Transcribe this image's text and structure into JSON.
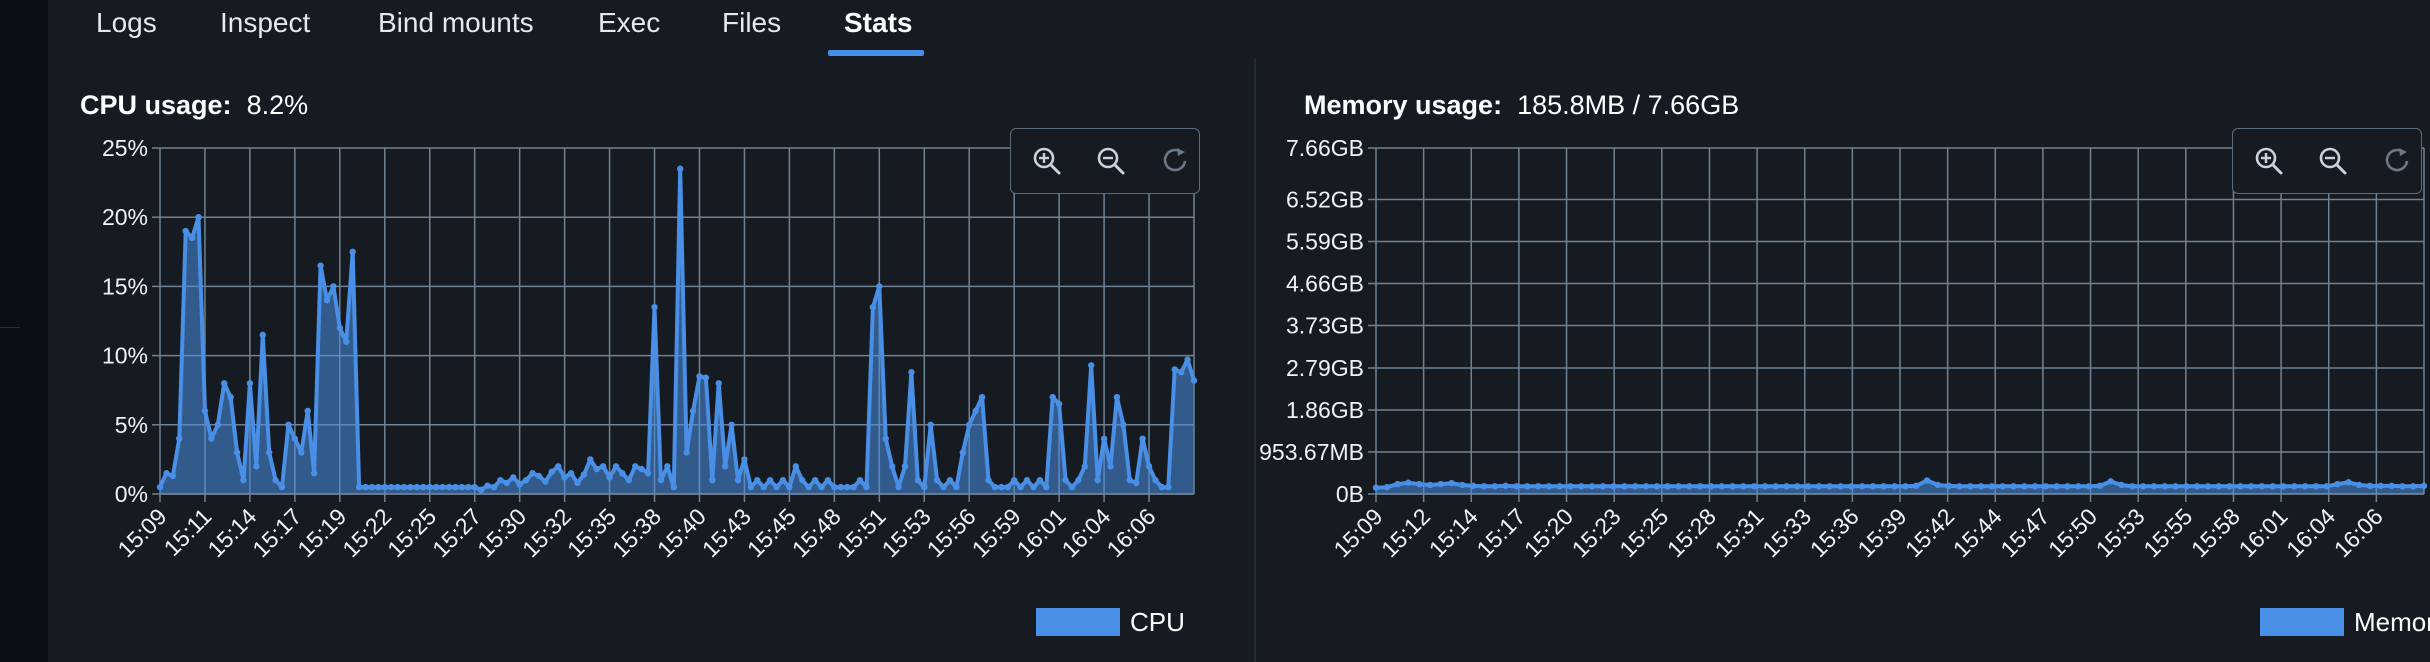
{
  "tabs": [
    {
      "label": "Logs",
      "active": false
    },
    {
      "label": "Inspect",
      "active": false
    },
    {
      "label": "Bind mounts",
      "active": false
    },
    {
      "label": "Exec",
      "active": false
    },
    {
      "label": "Files",
      "active": false
    },
    {
      "label": "Stats",
      "active": true
    }
  ],
  "colors": {
    "accent": "#4a8fe6",
    "grid": "#6f8193",
    "background": "#161b21"
  },
  "cpu": {
    "title_label": "CPU usage:",
    "title_value": "8.2%",
    "legend": "CPU",
    "zoom_icons": [
      "zoom-in-icon",
      "zoom-out-icon",
      "reset-icon"
    ]
  },
  "memory": {
    "title_label": "Memory usage:",
    "title_value": "185.8MB / 7.66GB",
    "legend": "Memory",
    "zoom_icons": [
      "zoom-in-icon",
      "zoom-out-icon",
      "reset-icon"
    ]
  },
  "chart_data": [
    {
      "type": "line",
      "title": "CPU usage: 8.2%",
      "ylim": [
        0,
        25
      ],
      "y_ticks": [
        "0%",
        "5%",
        "10%",
        "15%",
        "20%",
        "25%"
      ],
      "x_ticks": [
        "15:09",
        "15:11",
        "15:14",
        "15:17",
        "15:19",
        "15:22",
        "15:25",
        "15:27",
        "15:30",
        "15:32",
        "15:35",
        "15:38",
        "15:40",
        "15:43",
        "15:45",
        "15:48",
        "15:51",
        "15:53",
        "15:56",
        "15:59",
        "16:01",
        "16:04",
        "16:06"
      ],
      "grid": true,
      "legend": "bottom-right",
      "series": [
        {
          "name": "CPU",
          "values": [
            0.5,
            1.5,
            1.3,
            4,
            19,
            18.5,
            20,
            6,
            4,
            5,
            8,
            7,
            3,
            1,
            8,
            2,
            11.5,
            3,
            1,
            0.5,
            5,
            4,
            3,
            6,
            1.5,
            16.5,
            14,
            15,
            12,
            11,
            17.5,
            0.5,
            0.5,
            0.5,
            0.5,
            0.5,
            0.5,
            0.5,
            0.5,
            0.5,
            0.5,
            0.5,
            0.5,
            0.5,
            0.5,
            0.5,
            0.5,
            0.5,
            0.5,
            0.5,
            0.3,
            0.6,
            0.5,
            1,
            0.8,
            1.2,
            0.7,
            1,
            1.5,
            1.3,
            0.9,
            1.6,
            2,
            1.2,
            1.5,
            0.8,
            1.4,
            2.5,
            1.8,
            2,
            1.2,
            2,
            1.5,
            1,
            2,
            1.8,
            1.5,
            13.5,
            1,
            2,
            0.5,
            23.5,
            3,
            6,
            8.5,
            8.4,
            1,
            8,
            2,
            5,
            1,
            2.5,
            0.5,
            1,
            0.5,
            1,
            0.5,
            1,
            0.5,
            2,
            1,
            0.5,
            1,
            0.5,
            1,
            0.5,
            0.5,
            0.5,
            0.5,
            1,
            0.5,
            13.5,
            15,
            4,
            2,
            0.5,
            2,
            8.8,
            1,
            0.5,
            5,
            1,
            0.5,
            1,
            0.5,
            3,
            5,
            6,
            7,
            1,
            0.5,
            0.5,
            0.5,
            1,
            0.5,
            1,
            0.5,
            1,
            0.5,
            7,
            6.5,
            1,
            0.5,
            1,
            2,
            9.3,
            1,
            4,
            2,
            7,
            5,
            1,
            0.8,
            4,
            2,
            1,
            0.5,
            0.5,
            9,
            8.8,
            9.7,
            8.2
          ]
        }
      ]
    },
    {
      "type": "line",
      "title": "Memory usage: 185.8MB / 7.66GB",
      "ylim": [
        0,
        7.66
      ],
      "y_ticks": [
        "0B",
        "953.67MB",
        "1.86GB",
        "2.79GB",
        "3.73GB",
        "4.66GB",
        "5.59GB",
        "6.52GB",
        "7.66GB"
      ],
      "x_ticks": [
        "15:09",
        "15:12",
        "15:14",
        "15:17",
        "15:20",
        "15:23",
        "15:25",
        "15:28",
        "15:31",
        "15:33",
        "15:36",
        "15:39",
        "15:42",
        "15:44",
        "15:47",
        "15:50",
        "15:53",
        "15:55",
        "15:58",
        "16:01",
        "16:04",
        "16:06"
      ],
      "grid": true,
      "legend": "bottom-right",
      "series": [
        {
          "name": "Memory",
          "values": [
            0.14,
            0.15,
            0.22,
            0.25,
            0.22,
            0.2,
            0.22,
            0.24,
            0.2,
            0.18,
            0.17,
            0.17,
            0.18,
            0.17,
            0.17,
            0.17,
            0.17,
            0.17,
            0.17,
            0.17,
            0.17,
            0.17,
            0.17,
            0.17,
            0.17,
            0.17,
            0.17,
            0.17,
            0.17,
            0.17,
            0.17,
            0.17,
            0.17,
            0.17,
            0.17,
            0.17,
            0.17,
            0.17,
            0.17,
            0.17,
            0.17,
            0.17,
            0.17,
            0.17,
            0.17,
            0.17,
            0.17,
            0.17,
            0.17,
            0.17,
            0.18,
            0.3,
            0.2,
            0.18,
            0.17,
            0.17,
            0.17,
            0.17,
            0.17,
            0.17,
            0.17,
            0.17,
            0.17,
            0.17,
            0.17,
            0.17,
            0.17,
            0.18,
            0.28,
            0.2,
            0.17,
            0.17,
            0.17,
            0.17,
            0.17,
            0.17,
            0.17,
            0.17,
            0.17,
            0.17,
            0.17,
            0.17,
            0.17,
            0.17,
            0.17,
            0.17,
            0.17,
            0.17,
            0.17,
            0.22,
            0.26,
            0.2,
            0.18,
            0.18,
            0.18,
            0.17,
            0.17,
            0.18
          ]
        }
      ]
    }
  ]
}
